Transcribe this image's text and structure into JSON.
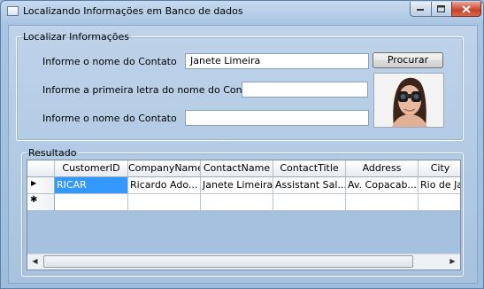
{
  "window": {
    "title": "Localizando Informações em Banco de dados"
  },
  "search_group": {
    "legend": "Localizar Informações",
    "label_name": "Informe o nome do Contato",
    "name_value": "Janete Limeira",
    "label_first_letter": "Informe a primeira letra do nome do Contato",
    "first_letter_value": "",
    "label_name_2": "Informe o nome do Contato",
    "name_2_value": "",
    "search_button": "Procurar"
  },
  "results_group": {
    "legend": "Resultado",
    "columns": [
      "CustomerID",
      "CompanyName",
      "ContactName",
      "ContactTitle",
      "Address",
      "City"
    ],
    "rows": [
      [
        "RICAR",
        "Ricardo Ado...",
        "Janete Limeira",
        "Assistant Sal...",
        "Av. Copacab...",
        "Rio de Ja"
      ]
    ],
    "current_row_marker": "▶",
    "new_row_marker": "✱"
  },
  "scrollbar": {
    "left_arrow": "◀",
    "right_arrow": "▶"
  },
  "colors": {
    "selection": "#3399ff",
    "close_button": "#c8412a",
    "window_background": "#a9c4e2"
  }
}
